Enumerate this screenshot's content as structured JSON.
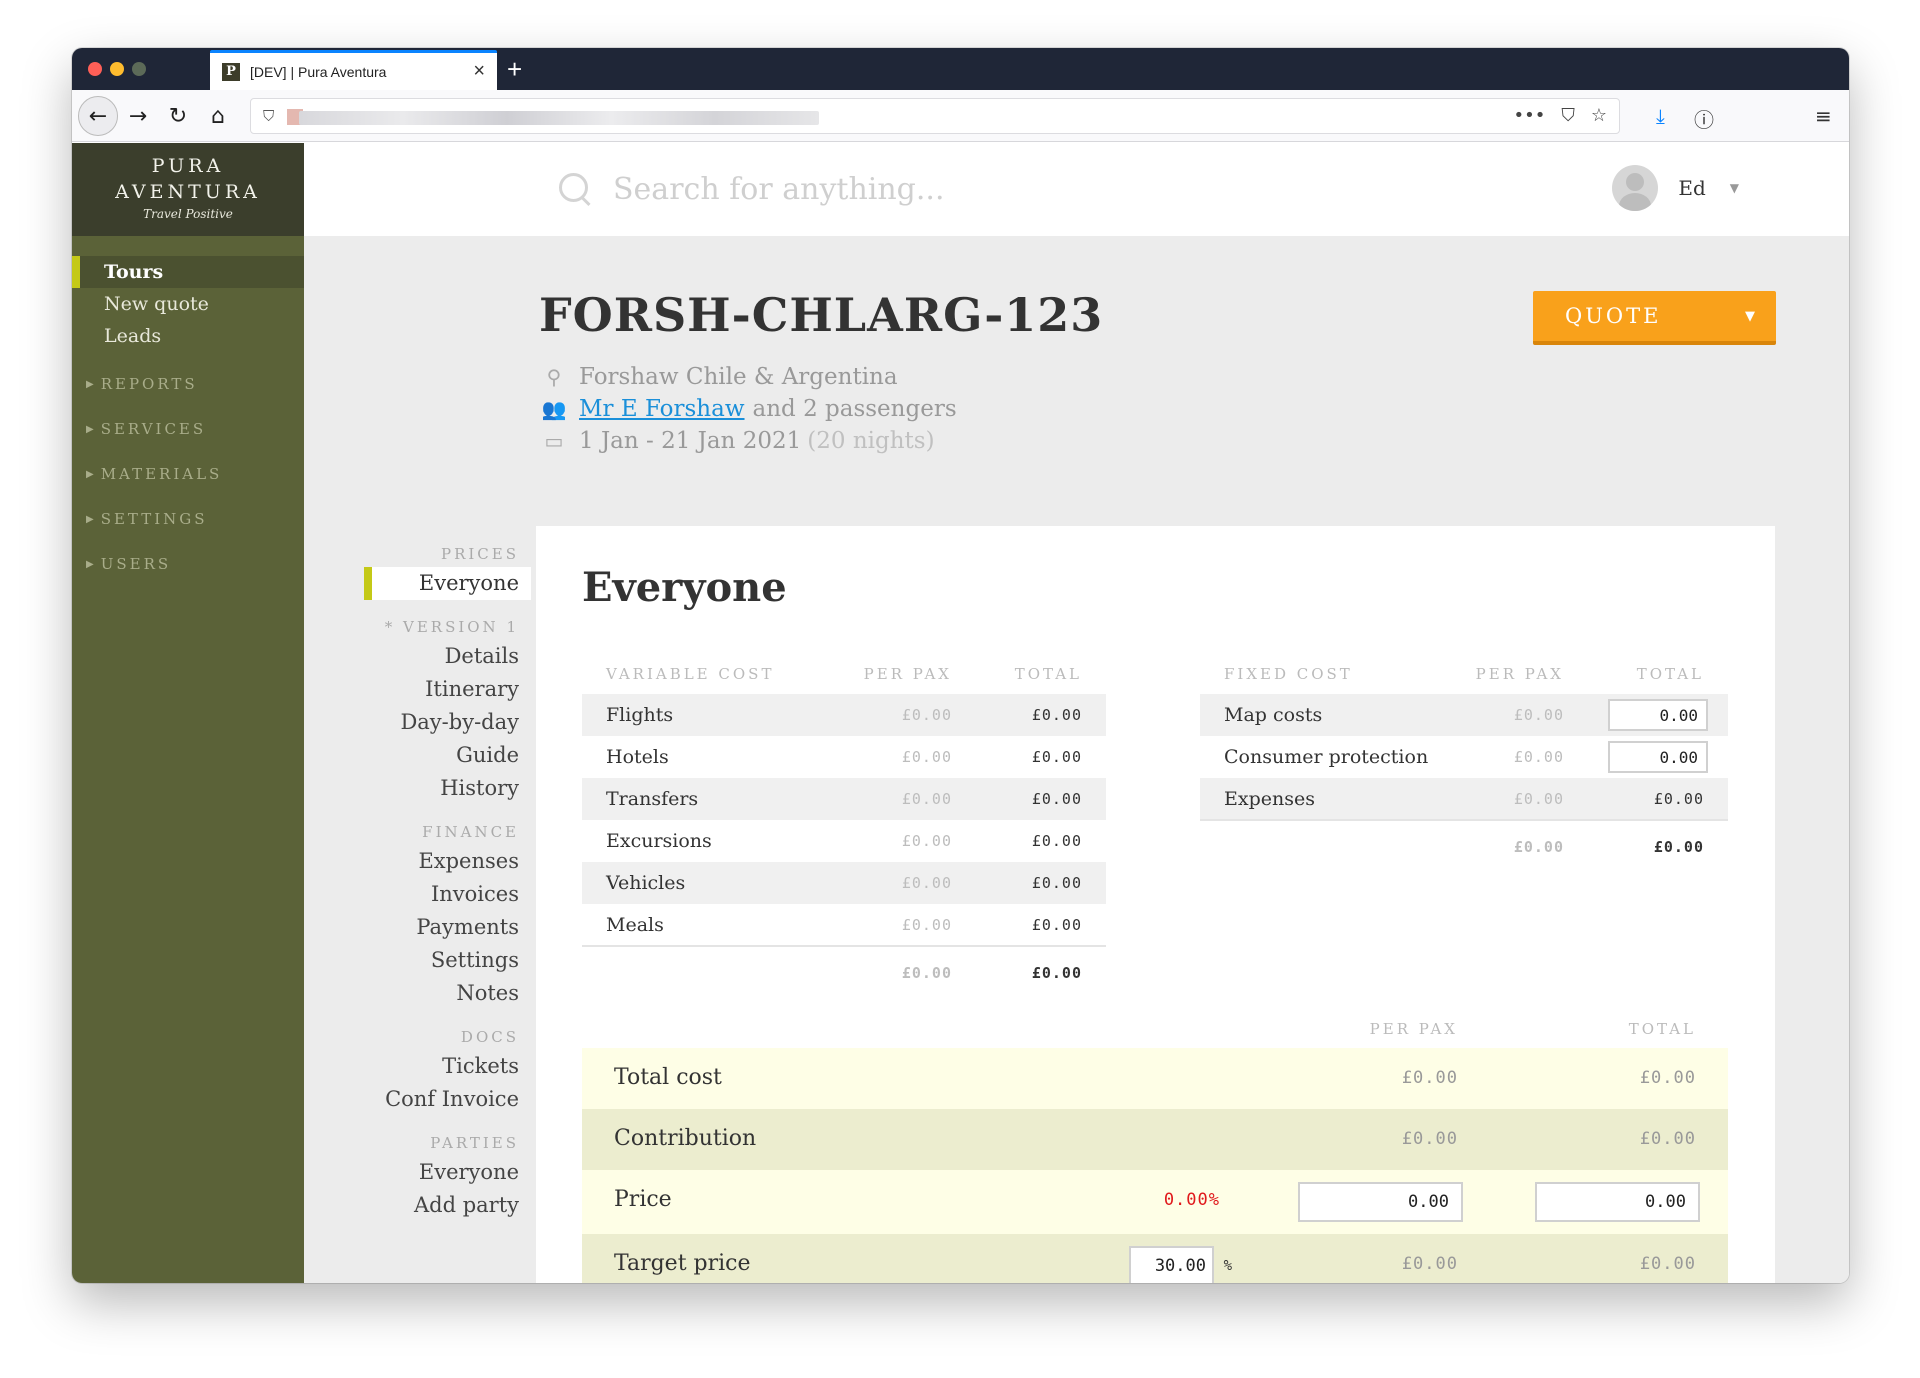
{
  "browser": {
    "tab_title": "[DEV] | Pura Aventura",
    "favicon_letter": "P",
    "close_glyph": "×",
    "new_tab_glyph": "+",
    "url_actions": [
      "•••",
      "⛉",
      "☆"
    ]
  },
  "logo": {
    "line1": "PURA",
    "line2": "AVENTURA",
    "tagline": "Travel Positive"
  },
  "sidebar": {
    "items": [
      {
        "label": "Tours",
        "active": true
      },
      {
        "label": "New quote"
      },
      {
        "label": "Leads"
      }
    ],
    "sections": [
      "REPORTS",
      "SERVICES",
      "MATERIALS",
      "SETTINGS",
      "USERS"
    ]
  },
  "search": {
    "placeholder": "Search for anything..."
  },
  "user": {
    "name": "Ed"
  },
  "tour": {
    "code": "FORSH-CHLARG-123",
    "name": "Forshaw Chile & Argentina",
    "lead_passenger": "Mr E Forshaw",
    "passengers_suffix": "and 2 passengers",
    "dates": "1 Jan - 21 Jan 2021",
    "nights": "(20 nights)"
  },
  "quote_button": {
    "label": "QUOTE",
    "caret": "▼"
  },
  "subnav": {
    "prices_head": "PRICES",
    "prices_items": [
      "Everyone"
    ],
    "version_head": "* VERSION 1",
    "version_items": [
      "Details",
      "Itinerary",
      "Day-by-day",
      "Guide",
      "History"
    ],
    "finance_head": "FINANCE",
    "finance_items": [
      "Expenses",
      "Invoices",
      "Payments",
      "Settings",
      "Notes"
    ],
    "docs_head": "DOCS",
    "docs_items": [
      "Tickets",
      "Conf Invoice"
    ],
    "parties_head": "PARTIES",
    "parties_items": [
      "Everyone",
      "Add party"
    ]
  },
  "panel": {
    "title": "Everyone"
  },
  "variable_cost": {
    "headers": [
      "VARIABLE COST",
      "PER PAX",
      "TOTAL"
    ],
    "rows": [
      {
        "label": "Flights",
        "per_pax": "£0.00",
        "total": "£0.00"
      },
      {
        "label": "Hotels",
        "per_pax": "£0.00",
        "total": "£0.00"
      },
      {
        "label": "Transfers",
        "per_pax": "£0.00",
        "total": "£0.00"
      },
      {
        "label": "Excursions",
        "per_pax": "£0.00",
        "total": "£0.00"
      },
      {
        "label": "Vehicles",
        "per_pax": "£0.00",
        "total": "£0.00"
      },
      {
        "label": "Meals",
        "per_pax": "£0.00",
        "total": "£0.00"
      }
    ],
    "sum_per_pax": "£0.00",
    "sum_total": "£0.00"
  },
  "fixed_cost": {
    "headers": [
      "FIXED COST",
      "PER PAX",
      "TOTAL"
    ],
    "rows": [
      {
        "label": "Map costs",
        "per_pax": "£0.00",
        "total_input": "0.00"
      },
      {
        "label": "Consumer protection",
        "per_pax": "£0.00",
        "total_input": "0.00"
      },
      {
        "label": "Expenses",
        "per_pax": "£0.00",
        "total": "£0.00"
      }
    ],
    "sum_per_pax": "£0.00",
    "sum_total": "£0.00"
  },
  "summary": {
    "headers": {
      "per_pax": "PER PAX",
      "total": "TOTAL"
    },
    "total_cost": {
      "label": "Total cost",
      "per_pax": "£0.00",
      "total": "£0.00"
    },
    "contribution": {
      "label": "Contribution",
      "per_pax": "£0.00",
      "total": "£0.00"
    },
    "price": {
      "label": "Price",
      "margin": "0.00%",
      "per_pax_input": "0.00",
      "total_input": "0.00"
    },
    "target_price": {
      "label": "Target price",
      "percent_input": "30.00",
      "percent_sign": "%",
      "per_pax": "£0.00",
      "total": "£0.00"
    }
  }
}
